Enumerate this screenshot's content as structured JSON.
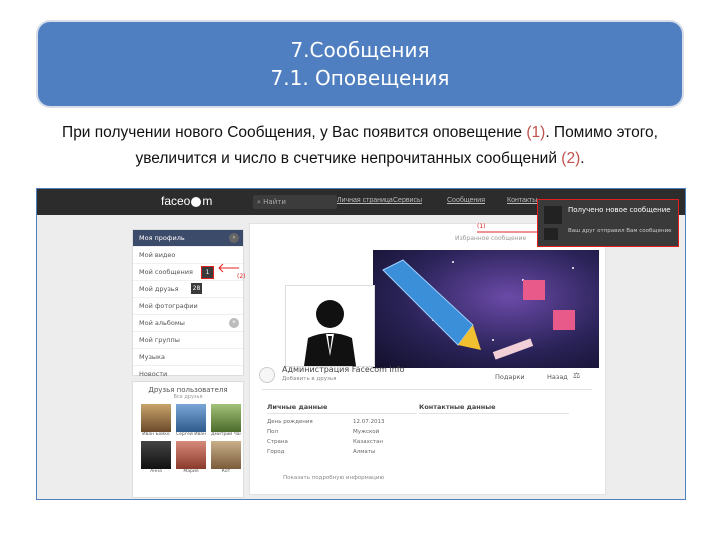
{
  "slide": {
    "title_line1": "7.Сообщения",
    "title_line2": "7.1. Оповещения",
    "intro_a": "При получении нового Сообщения, у Вас появится оповещение ",
    "intro_n1": "(1)",
    "intro_b": ". Помимо этого,",
    "intro_c": "увеличится и число в счетчике непрочитанных сообщений ",
    "intro_n2": "(2)",
    "intro_d": "."
  },
  "topbar": {
    "logo_left": "faceo",
    "logo_right": "m",
    "search_placeholder": "Найти",
    "nav": [
      "Личная страница",
      "Сервисы",
      "Сообщения",
      "Контакты"
    ]
  },
  "menu": {
    "items": [
      "Моя профиль",
      "Мой видео",
      "Мой сообщения",
      "Мой друзья",
      "Мой фотографии",
      "Мой альбомы",
      "Мой группы",
      "Музыка",
      "Новости"
    ],
    "messages_count": "1",
    "friends_count": "28"
  },
  "labels": {
    "one": "(1)",
    "two": "(2)"
  },
  "notification": {
    "title": "Получено новое сообщение",
    "body": "Ваш друг отправил Вам сообщение"
  },
  "profile": {
    "name": "Администрация Facecom Info",
    "sub": "Добавить в друзья",
    "status": "Избранное сообщение",
    "actions": [
      "Подарки",
      "Назад"
    ],
    "personal_title": "Личные данные",
    "contact_title": "Контактные данные",
    "fields": [
      "День рождения",
      "Пол",
      "Страна",
      "Город"
    ],
    "values": [
      "12.07.2013",
      "Мужской",
      "Казахстан",
      "Алматы"
    ],
    "more": "Показать подробную информацию"
  },
  "friends": {
    "title": "Друзья пользователя",
    "subtitle": "Все друзья",
    "names": [
      "Иван Бойко",
      "Сергей Иванов",
      "Дмитрий Чан",
      "Анна",
      "Мария",
      "Кот"
    ]
  },
  "colors": {
    "title_bg": "#4f7fc0",
    "highlight": "#e02020",
    "topbar": "#2c2c2c"
  }
}
